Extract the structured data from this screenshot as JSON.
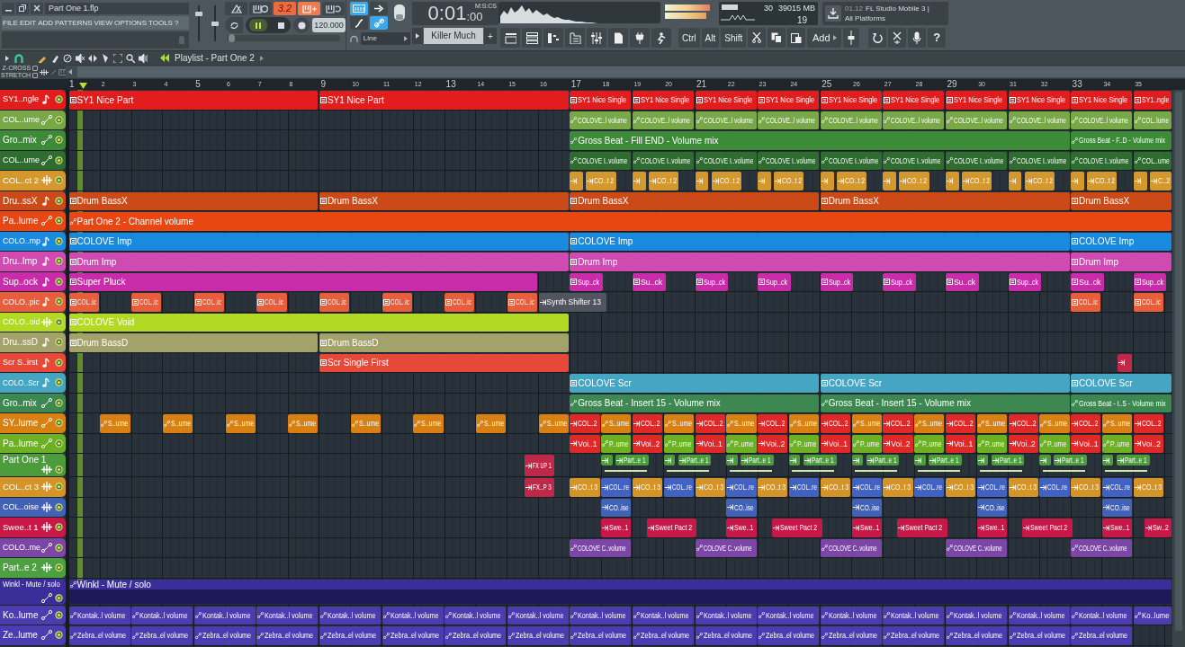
{
  "window": {
    "title": "Part One 1.flp"
  },
  "menu": [
    "FILE",
    "EDIT",
    "ADD",
    "PATTERNS",
    "VIEW",
    "OPTIONS",
    "TOOLS",
    "?"
  ],
  "mixer": {
    "master_volume": {
      "level": 0.8
    },
    "master_pitch": {
      "level": 0.5
    }
  },
  "transport": {
    "mode": "3.2",
    "tempo": "120.000",
    "time": "0:01",
    "time_fraction": ":00",
    "time_format": "M:S:CS",
    "song_position": {
      "level": 0.02
    }
  },
  "pattern": {
    "name": "Killer Much",
    "add": "+"
  },
  "snap": "Line",
  "monitor": {
    "cpu": "30",
    "memory": "39015 MB",
    "polyphony": "19"
  },
  "news": {
    "date": "01.12",
    "headline": "FL Studio Mobile 3 |",
    "subline": "All Platforms"
  },
  "keys": [
    "Ctrl",
    "Alt",
    "Shift"
  ],
  "add_menu": "Add",
  "help": "?",
  "playlist": {
    "title": "Playlist - Part One 2",
    "options": [
      {
        "label": "Z-CROSS",
        "checked": false
      },
      {
        "label": "STRETCH",
        "checked": false
      }
    ],
    "ruler": [
      "1",
      "2",
      "3",
      "4",
      "5",
      "6",
      "7",
      "8",
      "9",
      "10",
      "11",
      "12",
      "13",
      "14",
      "15",
      "16",
      "17",
      "18",
      "19",
      "20",
      "21",
      "22",
      "23",
      "24",
      "25",
      "26",
      "27",
      "28",
      "29",
      "30",
      "31",
      "32",
      "33",
      "34",
      "35"
    ],
    "tracks": [
      {
        "name": "SY1..ngle",
        "kind": "pattern",
        "color": "#e11d1d",
        "clips": [
          {
            "label": "SY1 Nice Part"
          },
          {
            "label": "SY1 Nice Part"
          },
          {
            "label": "SY1 Nice Single"
          },
          {
            "label": "SY1 Nice Single"
          },
          {
            "label": "SY1 Nice Single"
          },
          {
            "label": "SY1 Nice Single"
          },
          {
            "label": "SY1 Nice Single"
          },
          {
            "label": "SY1 Nice Single"
          },
          {
            "label": "SY1 Nice Single"
          },
          {
            "label": "SY1 Nice Single"
          },
          {
            "label": "SY1 Nice Single"
          },
          {
            "label": "SY1..ngle"
          }
        ]
      },
      {
        "name": "COL..ume",
        "kind": "automation",
        "color": "#78a847",
        "clips": [
          {
            "label": "COLOVE..l volume"
          },
          {
            "label": "COLOVE..l volume"
          },
          {
            "label": "COLOVE..l volume"
          },
          {
            "label": "COLOVE..l volume"
          },
          {
            "label": "COLOVE..l volume"
          },
          {
            "label": "COLOVE..l volume"
          },
          {
            "label": "COLOVE..l volume"
          },
          {
            "label": "COLOVE..l volume"
          },
          {
            "label": "COLOVE..l volume"
          },
          {
            "label": "COL..lume"
          }
        ]
      },
      {
        "name": "Gro..mix",
        "kind": "automation",
        "color": "#3d8a38",
        "clips": [
          {
            "label": "Gross Beat - Fill END - Volume mix"
          },
          {
            "label": "Gross Beat - F..D - Volume mix"
          }
        ]
      },
      {
        "name": "COL..ume",
        "kind": "automation",
        "color": "#2e6c30",
        "clips": [
          {
            "label": "COLOVE I..volume"
          },
          {
            "label": "COLOVE I..volume"
          },
          {
            "label": "COLOVE I..volume"
          },
          {
            "label": "COLOVE I..volume"
          },
          {
            "label": "COLOVE I..volume"
          },
          {
            "label": "COLOVE I..volume"
          },
          {
            "label": "COLOVE I..volume"
          },
          {
            "label": "COLOVE I..volume"
          },
          {
            "label": "COLOVE I..volume"
          },
          {
            "label": "COL..ume"
          }
        ]
      },
      {
        "name": "COL..ct 2",
        "kind": "audio",
        "color": "#d4982e",
        "clips": [
          {
            "kind": "audio"
          },
          {
            "label": "CO..t 2"
          },
          {
            "kind": "audio"
          },
          {
            "label": "CO..t 2"
          },
          {
            "kind": "audio"
          },
          {
            "label": "CO..t 2"
          },
          {
            "kind": "audio"
          },
          {
            "label": "CO..t 2"
          },
          {
            "kind": "audio"
          },
          {
            "label": "CO..t 2"
          },
          {
            "kind": "audio"
          },
          {
            "label": "CO..t 2"
          },
          {
            "kind": "audio"
          },
          {
            "label": "CO..t 2"
          },
          {
            "kind": "audio"
          },
          {
            "label": "CO..t 2"
          },
          {
            "kind": "audio"
          },
          {
            "label": "CO..t 2"
          },
          {
            "kind": "audio"
          },
          {
            "label": "C..2"
          }
        ]
      },
      {
        "name": "Dru..ssX",
        "kind": "pattern",
        "color": "#cc4a18",
        "clips": [
          {
            "label": "Drum BassX"
          },
          {
            "label": "Drum BassX"
          },
          {
            "label": "Drum BassX"
          },
          {
            "label": "Drum BassX"
          },
          {
            "label": "Drum BassX"
          }
        ]
      },
      {
        "name": "Pa..lume",
        "kind": "automation",
        "color": "#e84612",
        "clips": [
          {
            "label": "Part One 2 - Channel volume"
          }
        ]
      },
      {
        "name": "COLO..mp",
        "kind": "pattern",
        "color": "#1a8ae0",
        "clips": [
          {
            "label": "COLOVE Imp"
          },
          {
            "label": "COLOVE Imp"
          },
          {
            "label": "COLOVE Imp"
          }
        ]
      },
      {
        "name": "Dru..Imp",
        "kind": "pattern",
        "color": "#d04ab2",
        "clips": [
          {
            "label": "Drum Imp"
          },
          {
            "label": "Drum Imp"
          },
          {
            "label": "Drum Imp"
          }
        ]
      },
      {
        "name": "Sup..ock",
        "kind": "pattern",
        "color": "#c82ca8",
        "clips": [
          {
            "label": "Super Pluck"
          },
          {
            "label": "Sup..ck"
          },
          {
            "label": "Su..ck"
          },
          {
            "label": "Sup..ck"
          },
          {
            "label": "Sup..ck"
          },
          {
            "label": "Sup..ck"
          },
          {
            "label": "Sup..ck"
          },
          {
            "label": "Su..ck"
          },
          {
            "label": "Sup..ck"
          },
          {
            "label": "Su..ck"
          },
          {
            "label": "Sup..ck"
          }
        ]
      },
      {
        "name": "COLO..pic",
        "kind": "pattern",
        "color": "#e85e3c",
        "clips": [
          {
            "label": "COL..ic"
          },
          {
            "label": "COL..ic"
          },
          {
            "label": "COL..ic"
          },
          {
            "label": "COL..ic"
          },
          {
            "label": "COL..ic"
          },
          {
            "label": "COL..ic"
          },
          {
            "label": "COL..ic"
          },
          {
            "label": "COL..ic"
          },
          {
            "label": "Synth Shifter 13",
            "kind": "audio",
            "color": "#50555f"
          },
          {
            "label": "COL..ic"
          },
          {
            "label": "COL..ic"
          }
        ]
      },
      {
        "name": "COLO..oid",
        "kind": "audio",
        "color": "#b2da22",
        "clips": [
          {
            "label": "COLOVE Void",
            "kind": "pattern"
          }
        ]
      },
      {
        "name": "Dru..ssD",
        "kind": "pattern",
        "color": "#a2a26a",
        "clips": [
          {
            "label": "Drum BassD"
          },
          {
            "label": "Drum BassD"
          }
        ]
      },
      {
        "name": "Scr S..irst",
        "kind": "pattern",
        "color": "#e84838",
        "clips": [
          {
            "label": "Scr Single First"
          },
          {
            "kind": "audio",
            "color": "#c02848"
          }
        ]
      },
      {
        "name": "COLO..Scr",
        "kind": "pattern",
        "color": "#44a6c2",
        "clips": [
          {
            "label": "COLOVE Scr"
          },
          {
            "label": "COLOVE Scr"
          },
          {
            "label": "COLOVE Scr"
          }
        ]
      },
      {
        "name": "Gro..mix",
        "kind": "automation",
        "color": "#3c8850",
        "clips": [
          {
            "label": "Gross Beat - Insert 15 - Volume mix"
          },
          {
            "label": "Gross Beat - Insert 15 - Volume mix"
          },
          {
            "label": "Gross Beat - I..5 - Volume mix"
          }
        ]
      },
      {
        "name": "SY..lume",
        "kind": "automation",
        "color": "#d88012",
        "clips": [
          {
            "label": "S..ume"
          },
          {
            "label": "S..ume"
          },
          {
            "label": "S..ume"
          },
          {
            "label": "S..ume"
          },
          {
            "label": "S..ume"
          },
          {
            "label": "S..ume"
          },
          {
            "label": "S..ume"
          },
          {
            "label": "S..ume"
          },
          {
            "label": "COL..2",
            "kind": "audio",
            "color": "#e02828"
          },
          {
            "label": "S..ume"
          },
          {
            "label": "COL..2",
            "kind": "audio",
            "color": "#e02828"
          },
          {
            "label": "S..ume"
          },
          {
            "label": "COL..2",
            "kind": "audio",
            "color": "#e02828"
          },
          {
            "label": "S..ume"
          },
          {
            "label": "COL..2",
            "kind": "audio",
            "color": "#e02828"
          },
          {
            "label": "S..ume"
          },
          {
            "label": "COL..2",
            "kind": "audio",
            "color": "#e02828"
          },
          {
            "label": "S..ume"
          },
          {
            "label": "COL..2",
            "kind": "audio",
            "color": "#e02828"
          },
          {
            "label": "S..ume"
          },
          {
            "label": "COL..2",
            "kind": "audio",
            "color": "#e02828"
          },
          {
            "label": "S..ume"
          },
          {
            "label": "COL..2",
            "kind": "audio",
            "color": "#e02828"
          },
          {
            "label": "S..ume"
          },
          {
            "label": "COL..2",
            "kind": "audio",
            "color": "#e02828"
          },
          {
            "label": "S..ume"
          },
          {
            "label": "COL..2",
            "kind": "audio",
            "color": "#e02828"
          }
        ]
      },
      {
        "name": "Pa..lume",
        "kind": "automation",
        "color": "#6cb024",
        "clips": [
          {
            "label": "Voi..1",
            "kind": "audio",
            "color": "#e02828"
          },
          {
            "label": "P..ume"
          },
          {
            "label": "Voi..2",
            "kind": "audio",
            "color": "#e02828"
          },
          {
            "label": "P..ume"
          },
          {
            "label": "Voi..1",
            "kind": "audio",
            "color": "#e02828"
          },
          {
            "label": "P..ume"
          },
          {
            "label": "Voi..2",
            "kind": "audio",
            "color": "#e02828"
          },
          {
            "label": "P..ume"
          },
          {
            "label": "Voi..1",
            "kind": "audio",
            "color": "#e02828"
          },
          {
            "label": "P..ume"
          },
          {
            "label": "Voi..2",
            "kind": "audio",
            "color": "#e02828"
          },
          {
            "label": "P..ume"
          },
          {
            "label": "Voi..1",
            "kind": "audio",
            "color": "#e02828"
          },
          {
            "label": "P..ume"
          },
          {
            "label": "Voi..2",
            "kind": "audio",
            "color": "#e02828"
          },
          {
            "label": "P..ume"
          },
          {
            "label": "Voi..1",
            "kind": "audio",
            "color": "#e02828"
          },
          {
            "label": "P..ume"
          },
          {
            "label": "Voi..2",
            "kind": "audio",
            "color": "#e02828"
          }
        ]
      },
      {
        "name": "Part One 1",
        "kind": "audio",
        "color": "#4c9c3c",
        "clips": [
          {
            "label": "FX UP 1",
            "color": "#c02848"
          },
          {
            "kind": "audio"
          },
          {
            "label": "Part..e 1"
          },
          {
            "kind": "audio"
          },
          {
            "label": "Part..e 1"
          },
          {
            "kind": "audio"
          },
          {
            "label": "Part..e 1"
          },
          {
            "kind": "audio"
          },
          {
            "label": "Part..e 1"
          },
          {
            "kind": "audio"
          },
          {
            "label": "Part..e 1"
          },
          {
            "kind": "audio"
          },
          {
            "label": "Part..e 1"
          },
          {
            "kind": "audio"
          },
          {
            "label": "Part..e 1"
          },
          {
            "kind": "audio"
          },
          {
            "label": "Part..e 1"
          },
          {
            "kind": "audio"
          },
          {
            "label": "Part..e 1"
          }
        ]
      },
      {
        "name": "COL..ct 3",
        "kind": "audio",
        "color": "#d49428",
        "clips": [
          {
            "label": "FX..P 3",
            "color": "#c02848"
          },
          {
            "label": "CO..t 3"
          },
          {
            "label": "COL..re",
            "color": "#4262c2"
          },
          {
            "label": "CO..t 3"
          },
          {
            "label": "COL..re",
            "color": "#4262c2"
          },
          {
            "label": "CO..t 3"
          },
          {
            "label": "COL..re",
            "color": "#4262c2"
          },
          {
            "label": "CO..t 3"
          },
          {
            "label": "COL..re",
            "color": "#4262c2"
          },
          {
            "label": "CO..t 3"
          },
          {
            "label": "COL..re",
            "color": "#4262c2"
          },
          {
            "label": "CO..t 3"
          },
          {
            "label": "COL..re",
            "color": "#4262c2"
          },
          {
            "label": "CO..t 3"
          },
          {
            "label": "COL..re",
            "color": "#4262c2"
          },
          {
            "label": "CO..t 3"
          },
          {
            "label": "COL..re",
            "color": "#4262c2"
          },
          {
            "label": "CO..t 3"
          },
          {
            "label": "COL..re",
            "color": "#4262c2"
          },
          {
            "label": "CO..t 3"
          }
        ]
      },
      {
        "name": "COL..oise",
        "kind": "audio",
        "color": "#4262b8",
        "clips": [
          {
            "label": "CO..ise"
          },
          {
            "label": "CO..ise"
          },
          {
            "label": "CO..ise"
          },
          {
            "label": "CO..ise"
          },
          {
            "label": "CO..ise"
          }
        ]
      },
      {
        "name": "Swee..t 1",
        "kind": "audio",
        "color": "#c81848",
        "clips": [
          {
            "label": "Swe..1"
          },
          {
            "label": "Sweet Pact 2"
          },
          {
            "label": "Swe..1"
          },
          {
            "label": "Sweet Pact 2"
          },
          {
            "label": "Swe..1"
          },
          {
            "label": "Sweet Pact 2"
          },
          {
            "label": "Swe..1"
          },
          {
            "label": "Sweet Pact 2"
          },
          {
            "label": "Swe..1"
          },
          {
            "label": "Sw..2"
          }
        ]
      },
      {
        "name": "COLO..me",
        "kind": "automation",
        "color": "#7c46a6",
        "clips": [
          {
            "label": "COLOVE C..volume"
          },
          {
            "label": "COLOVE C..volume"
          },
          {
            "label": "COLOVE C..volume"
          },
          {
            "label": "COLOVE C..volume"
          },
          {
            "label": "COLOVE C..volume"
          }
        ]
      },
      {
        "name": "Part..e 2",
        "kind": "audio",
        "color": "#4ca040"
      },
      {
        "name": "Winkl - Mute / solo",
        "kind": "automation",
        "color": "#3a2e98",
        "clips": [
          {
            "label": "Winkl - Mute / solo"
          }
        ]
      },
      {
        "name": "Ko..lume",
        "kind": "automation",
        "color": "#4c3cb0",
        "clips": [
          {
            "label": "Kontak..l volume"
          },
          {
            "label": "Kontak..l volume"
          },
          {
            "label": "Kontak..l volume"
          },
          {
            "label": "Kontak..l volume"
          },
          {
            "label": "Kontak..l volume"
          },
          {
            "label": "Kontak..l volume"
          },
          {
            "label": "Kontak..l volume"
          },
          {
            "label": "Kontak..l volume"
          },
          {
            "label": "Kontak..l volume"
          },
          {
            "label": "Kontak..l volume"
          },
          {
            "label": "Kontak..l volume"
          },
          {
            "label": "Kontak..l volume"
          },
          {
            "label": "Kontak..l volume"
          },
          {
            "label": "Kontak..l volume"
          },
          {
            "label": "Kontak..l volume"
          },
          {
            "label": "Kontak..l volume"
          },
          {
            "label": "Kontak..l volume"
          },
          {
            "label": "Ko..lume"
          }
        ]
      },
      {
        "name": "Ze..lume",
        "kind": "automation",
        "color": "#4c3cb0",
        "clips": [
          {
            "label": "Zebra..el volume"
          },
          {
            "label": "Zebra..el volume"
          },
          {
            "label": "Zebra..el volume"
          },
          {
            "label": "Zebra..el volume"
          },
          {
            "label": "Zebra..el volume"
          },
          {
            "label": "Zebra..el volume"
          },
          {
            "label": "Zebra..el volume"
          },
          {
            "label": "Zebra..el volume"
          },
          {
            "label": "Zebra..el volume"
          },
          {
            "label": "Zebra..el volume"
          },
          {
            "label": "Zebra..el volume"
          },
          {
            "label": "Zebra..el volume"
          },
          {
            "label": "Zebra..el volume"
          },
          {
            "label": "Zebra..el volume"
          },
          {
            "label": "Zebra..el volume"
          },
          {
            "label": "Zebra..el volume"
          },
          {
            "label": "Zebra..el volume"
          }
        ]
      }
    ]
  }
}
